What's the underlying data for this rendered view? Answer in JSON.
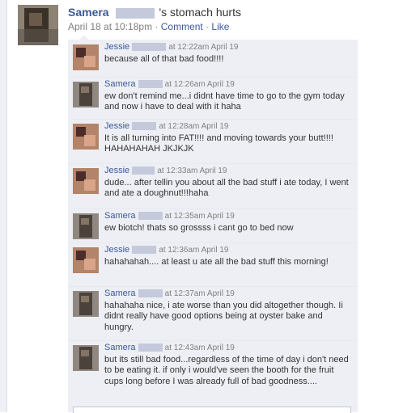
{
  "post": {
    "author": "Samera",
    "status": "'s stomach hurts",
    "date": "April 18 at 10:18pm",
    "separator1": " · ",
    "comment_link": "Comment",
    "separator2": " · ",
    "like_link": "Like"
  },
  "comments": [
    {
      "name": "Jessie",
      "time": "at 12:22am April 19",
      "text": "because all of that bad food!!!!",
      "avatar": "jessie"
    },
    {
      "name": "Samera",
      "time": "at 12:26am April 19",
      "text": "ew don't remind me...i didnt have time to go to the gym today and now i have to deal with it haha",
      "avatar": "samera"
    },
    {
      "name": "Jessie",
      "time": "at 12:28am April 19",
      "text": "It is all turning into FAT!!!! and moving towards your butt!!!! HAHAHAHAH JKJKJK",
      "avatar": "jessie"
    },
    {
      "name": "Jessie",
      "time": "at 12:33am April 19",
      "text": "dude... after tellin you about all the bad stuff i ate today, I went and ate a doughnut!!!haha",
      "avatar": "jessie"
    },
    {
      "name": "Samera",
      "time": "at 12:35am April 19",
      "text": "ew biotch! thats so grossss i cant go to bed now",
      "avatar": "samera"
    },
    {
      "name": "Jessie",
      "time": "at 12:36am April 19",
      "text": "hahahahah.... at least u ate all the bad stuff this morning!",
      "avatar": "jessie"
    },
    {
      "name": "Samera",
      "time": "at 12:37am April 19",
      "text": "hahahaha nice, i ate worse than you did altogether though. Ii didnt really have good options being at oyster bake and hungry.",
      "avatar": "samera"
    },
    {
      "name": "Samera",
      "time": "at 12:43am April 19",
      "text": "but its still bad food...regardless of the time of day i don't need to be eating it. if only i would've seen the booth for the fruit cups long before I was already full of bad goodness....",
      "avatar": "samera"
    }
  ]
}
